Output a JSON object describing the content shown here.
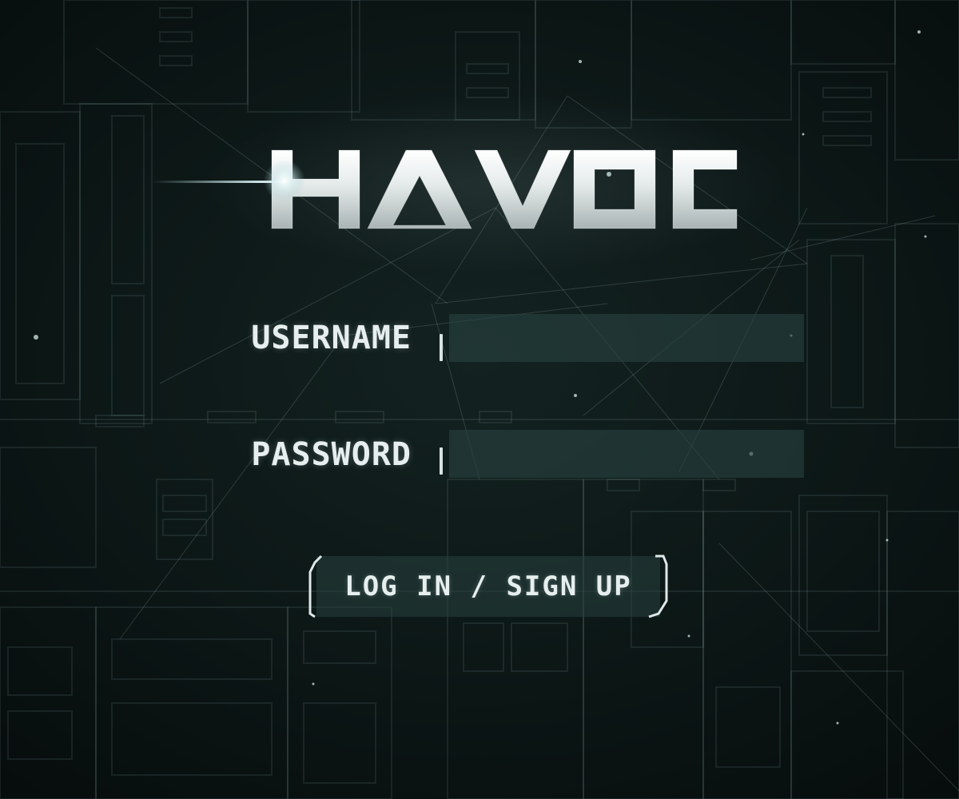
{
  "app": {
    "logo_text": "HAVOC"
  },
  "form": {
    "username_label": "USERNAME",
    "username_value": "",
    "password_label": "PASSWORD",
    "password_value": "",
    "submit_label": "LOG IN / SIGN UP"
  },
  "icons": {
    "caret": "text-caret-icon",
    "button_frame": "bracket-frame-icon"
  },
  "colors": {
    "background": "#0b1313",
    "text": "#e6eeee",
    "field_fill": "#284240",
    "line_art": "#8fa9a6"
  }
}
